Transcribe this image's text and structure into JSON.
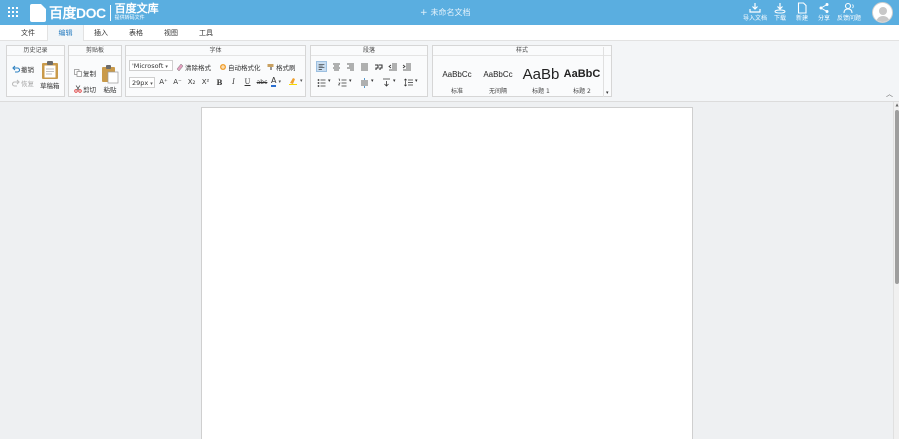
{
  "topbar": {
    "logo_text": "百度DOC",
    "brand_title": "百度文库",
    "brand_subtitle": "提供转码文件",
    "doc_title_prefix": "+",
    "doc_title": "未命名文档",
    "tools": [
      {
        "label": "导入文档",
        "icon": "import-icon"
      },
      {
        "label": "下载",
        "icon": "download-icon"
      },
      {
        "label": "新建",
        "icon": "new-file-icon"
      },
      {
        "label": "分享",
        "icon": "share-icon"
      },
      {
        "label": "反馈问题",
        "icon": "feedback-icon"
      }
    ],
    "bar_color": "#5aaee0"
  },
  "menu": {
    "tabs": [
      {
        "label": "文件"
      },
      {
        "label": "编辑",
        "active": true
      },
      {
        "label": "插入"
      },
      {
        "label": "表格"
      },
      {
        "label": "视图"
      },
      {
        "label": "工具"
      }
    ]
  },
  "ribbon": {
    "history": {
      "title": "历史记录",
      "undo": "撤销",
      "redo": "恢复",
      "draft": "草稿箱"
    },
    "clipboard": {
      "title": "剪贴板",
      "copy": "复制",
      "cut": "剪切",
      "paste": "粘贴"
    },
    "font": {
      "title": "字体",
      "family": "'Microsoft",
      "clear_format": "清除格式",
      "auto_format": "自动格式化",
      "format_painter": "格式刷",
      "size": "29px",
      "grow": "A⁺",
      "shrink": "A⁻",
      "subscript": "X₂",
      "superscript": "X²",
      "bold": "B",
      "italic": "I",
      "underline": "U",
      "strike": "abc",
      "font_color": "A"
    },
    "paragraph": {
      "title": "段落"
    },
    "styles": {
      "title": "样式",
      "items": [
        {
          "sample": "AaBbCc",
          "label": "标准"
        },
        {
          "sample": "AaBbCc",
          "label": "无间隔"
        },
        {
          "sample": "AaBb",
          "label": "标题 1"
        },
        {
          "sample": "AaBbC",
          "label": "标题 2"
        }
      ]
    }
  }
}
